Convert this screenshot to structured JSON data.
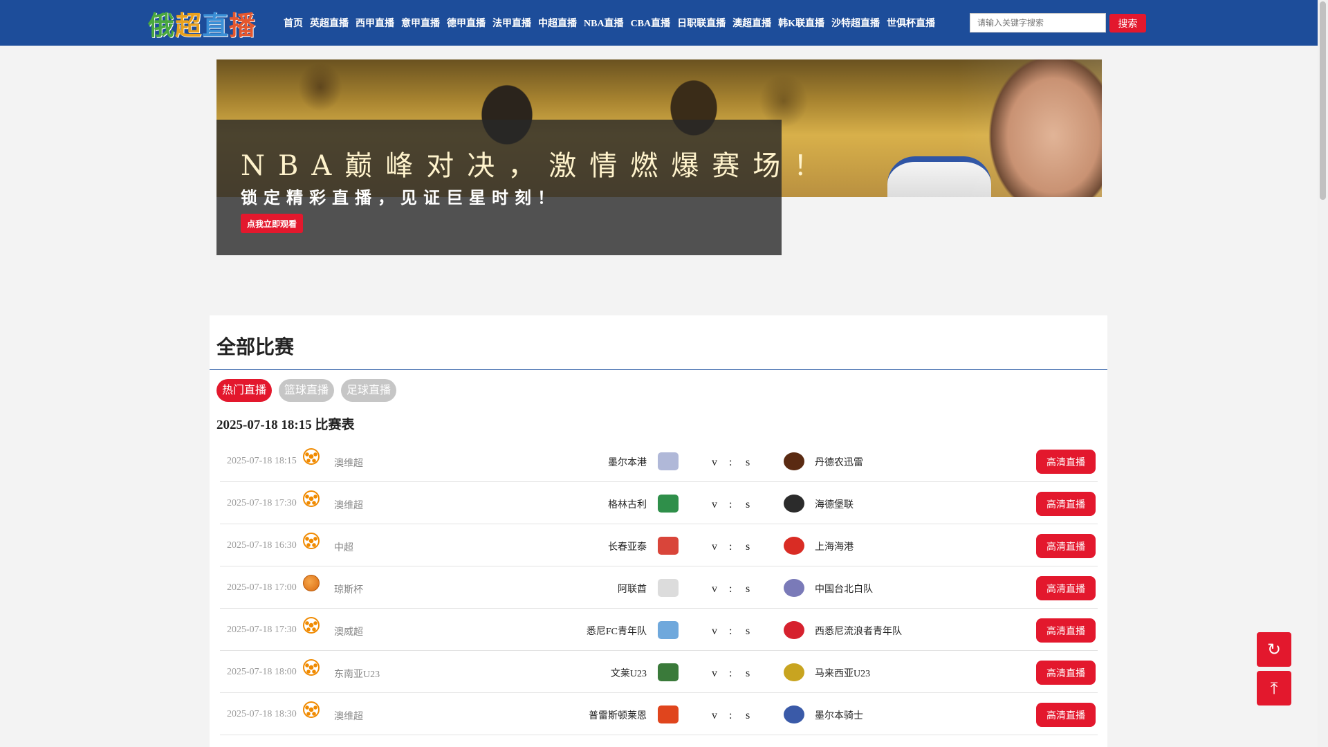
{
  "header": {
    "logo_text": "俄超直播",
    "logo_colors": [
      "#4aa83e",
      "#e8a11e",
      "#3a8fd6",
      "#e4572e"
    ],
    "nav": [
      "首页",
      "英超直播",
      "西甲直播",
      "意甲直播",
      "德甲直播",
      "法甲直播",
      "中超直播",
      "NBA直播",
      "CBA直播",
      "日职联直播",
      "澳超直播",
      "韩K联直播",
      "沙特超直播",
      "世俱杯直播"
    ],
    "search_placeholder": "请输入关键字搜索",
    "search_button": "搜索"
  },
  "banner": {
    "title": "NBA巅峰对决，激情燃爆赛场！",
    "subtitle": "锁定精彩直播，见证巨星时刻！",
    "button": "点我立即观看"
  },
  "panel": {
    "title": "全部比赛",
    "tabs": [
      "热门直播",
      "篮球直播",
      "足球直播"
    ],
    "active_tab": 0,
    "schedule_heading": "2025-07-18 18:15 比赛表"
  },
  "matches": [
    {
      "time": "2025-07-18 18:15",
      "sport": "soccer-icon",
      "league": "澳维超",
      "home": "墨尔本港",
      "home_color": "#b0b8d8",
      "away": "丹德农迅雷",
      "away_color": "#5a2a12",
      "v": "v",
      "colon": ":",
      "s": "s",
      "action": "高清直播"
    },
    {
      "time": "2025-07-18 17:30",
      "sport": "soccer-icon",
      "league": "澳维超",
      "home": "格林古利",
      "home_color": "#2f8f4a",
      "away": "海德堡联",
      "away_color": "#2b2b2b",
      "v": "v",
      "colon": ":",
      "s": "s",
      "action": "高清直播"
    },
    {
      "time": "2025-07-18 16:30",
      "sport": "soccer-icon",
      "league": "中超",
      "home": "长春亚泰",
      "home_color": "#d9453a",
      "away": "上海海港",
      "away_color": "#d92c24",
      "v": "v",
      "colon": ":",
      "s": "s",
      "action": "高清直播"
    },
    {
      "time": "2025-07-18 17:00",
      "sport": "basketball-icon",
      "league": "琼斯杯",
      "home": "阿联酋",
      "home_color": "#dcdcdc",
      "away": "中国台北白队",
      "away_color": "#7a7ab8",
      "v": "v",
      "colon": ":",
      "s": "s",
      "action": "高清直播"
    },
    {
      "time": "2025-07-18 17:30",
      "sport": "soccer-icon",
      "league": "澳威超",
      "home": "悉尼FC青年队",
      "home_color": "#6fa8dc",
      "away": "西悉尼流浪者青年队",
      "away_color": "#d6212e",
      "v": "v",
      "colon": ":",
      "s": "s",
      "action": "高清直播"
    },
    {
      "time": "2025-07-18 18:00",
      "sport": "soccer-icon",
      "league": "东南亚U23",
      "home": "文莱U23",
      "home_color": "#3a7a3a",
      "away": "马来西亚U23",
      "away_color": "#c8a420",
      "v": "v",
      "colon": ":",
      "s": "s",
      "action": "高清直播"
    },
    {
      "time": "2025-07-18 18:30",
      "sport": "soccer-icon",
      "league": "澳维超",
      "home": "普雷斯顿莱恩",
      "home_color": "#e0451d",
      "away": "墨尔本骑士",
      "away_color": "#3a5aa8",
      "v": "v",
      "colon": ":",
      "s": "s",
      "action": "高清直播"
    }
  ],
  "float_buttons": {
    "refresh": "↻",
    "top": "⤒"
  }
}
